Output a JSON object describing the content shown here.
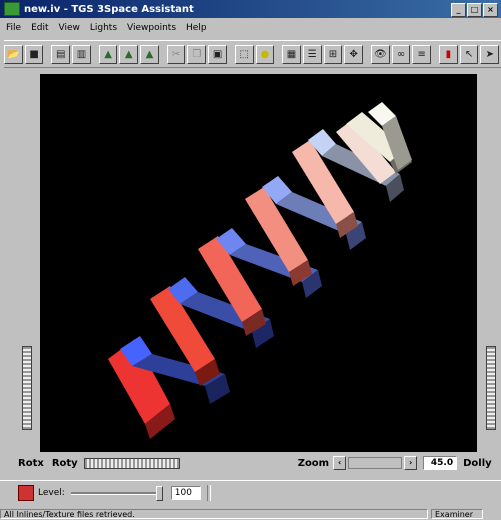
{
  "window": {
    "title": "new.iv - TGS 3Space Assistant",
    "buttons": [
      "_",
      "□",
      "×"
    ]
  },
  "menu": [
    "File",
    "Edit",
    "View",
    "Lights",
    "Viewpoints",
    "Help"
  ],
  "toolbar": {
    "buttons": [
      "open-icon",
      "save-icon",
      "print-icon",
      "print-preview-icon",
      "scene-icon",
      "scene-icon",
      "scene-icon",
      "cut-icon",
      "copy-icon",
      "paste-icon",
      "select-icon",
      "light-icon",
      "object-icon",
      "object-icon",
      "grid-icon",
      "move-icon",
      "view-icon",
      "binoculars-icon",
      "list-icon",
      "pick-icon",
      "arrow-icon",
      "cursor-icon"
    ]
  },
  "viewer": {
    "rotx_label": "Rotx",
    "roty_label": "Roty",
    "zoom_label": "Zoom",
    "zoom_value": "45.0",
    "dolly_label": "Dolly"
  },
  "level": {
    "label": "Level:",
    "value": "100"
  },
  "status": {
    "message": "All Inlines/Texture files retrieved.",
    "mode": "Examiner"
  }
}
